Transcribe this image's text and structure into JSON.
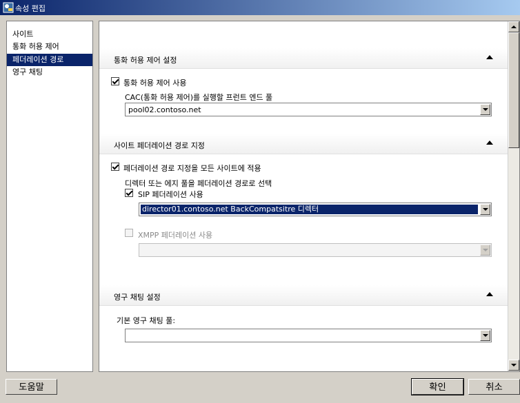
{
  "window": {
    "title": "속성 편집",
    "title_icon": "properties-icon"
  },
  "nav": {
    "items": [
      {
        "label": "사이트"
      },
      {
        "label": "통화 허용 제어"
      },
      {
        "label": "페더레이션 경로"
      },
      {
        "label": "영구 채팅"
      }
    ],
    "selected": "페더레이션 경로"
  },
  "sections": {
    "cac": {
      "title": "통화 허용 제어 설정",
      "enable_label": "통화 허용 제어 사용",
      "enable_checked": true,
      "pool_label": "CAC(통화 허용 제어)를 실행할 프런트 엔드 풀",
      "pool_value": "pool02.contoso.net"
    },
    "federation": {
      "title": "사이트 페더레이션 경로 지정",
      "apply_all_label": "페더레이션 경로 지정을 모든 사이트에 적용",
      "apply_all_checked": true,
      "select_label": "디렉터 또는 에지 풀을 페더레이션 경로로 선택",
      "sip_label": "SIP 페더레이션 사용",
      "sip_checked": true,
      "sip_value": "director01.contoso.net   BackCompatsitre 디렉터",
      "xmpp_label": "XMPP 페더레이션 사용",
      "xmpp_checked": false,
      "xmpp_value": ""
    },
    "chat": {
      "title": "영구 채팅 설정",
      "pool_label": "기본 영구 채팅 풀:",
      "pool_value": ""
    }
  },
  "buttons": {
    "help": "도움말",
    "ok": "확인",
    "cancel": "취소"
  }
}
